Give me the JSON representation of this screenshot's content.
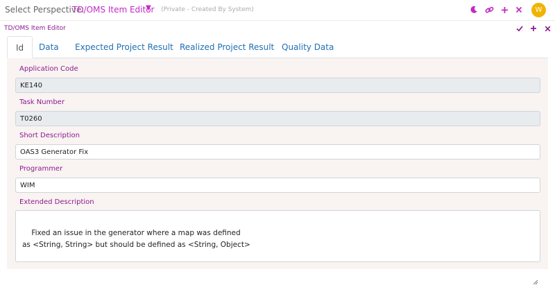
{
  "header": {
    "perspective_label": "Select Perspective:",
    "perspective_value": "TD/OMS Item Editor",
    "perspective_note": "(Private - Created By System)",
    "avatar_initial": "W",
    "icons": [
      "moon-icon",
      "link-icon",
      "plus-icon",
      "close-icon"
    ]
  },
  "panel": {
    "title": "TD/OMS Item Editor",
    "icons": [
      "check-icon",
      "plus-icon",
      "close-icon"
    ]
  },
  "tabs": [
    {
      "label": "Id",
      "active": true
    },
    {
      "label": "Data",
      "active": false
    },
    {
      "label": "Expected Project Result",
      "active": false
    },
    {
      "label": "Realized Project Result",
      "active": false
    },
    {
      "label": "Quality Data",
      "active": false
    }
  ],
  "fields": {
    "application_code": {
      "label": "Application Code",
      "value": "KE140"
    },
    "task_number": {
      "label": "Task Number",
      "value": "T0260"
    },
    "short_description": {
      "label": "Short Description",
      "value": "OAS3 Generator Fix"
    },
    "programmer": {
      "label": "Programmer",
      "value": "WIM"
    },
    "extended_description": {
      "label": "Extended Description",
      "value": "Fixed an issue in the generator where a map was defined\nas <String, String> but should be defined as <String, Object>"
    }
  },
  "colors": {
    "accent_magenta": "#c02bc4",
    "label_purple": "#8a1a8e",
    "tab_blue": "#1f6fb5",
    "avatar": "#f0b400",
    "form_bg": "#f9f3f2"
  }
}
